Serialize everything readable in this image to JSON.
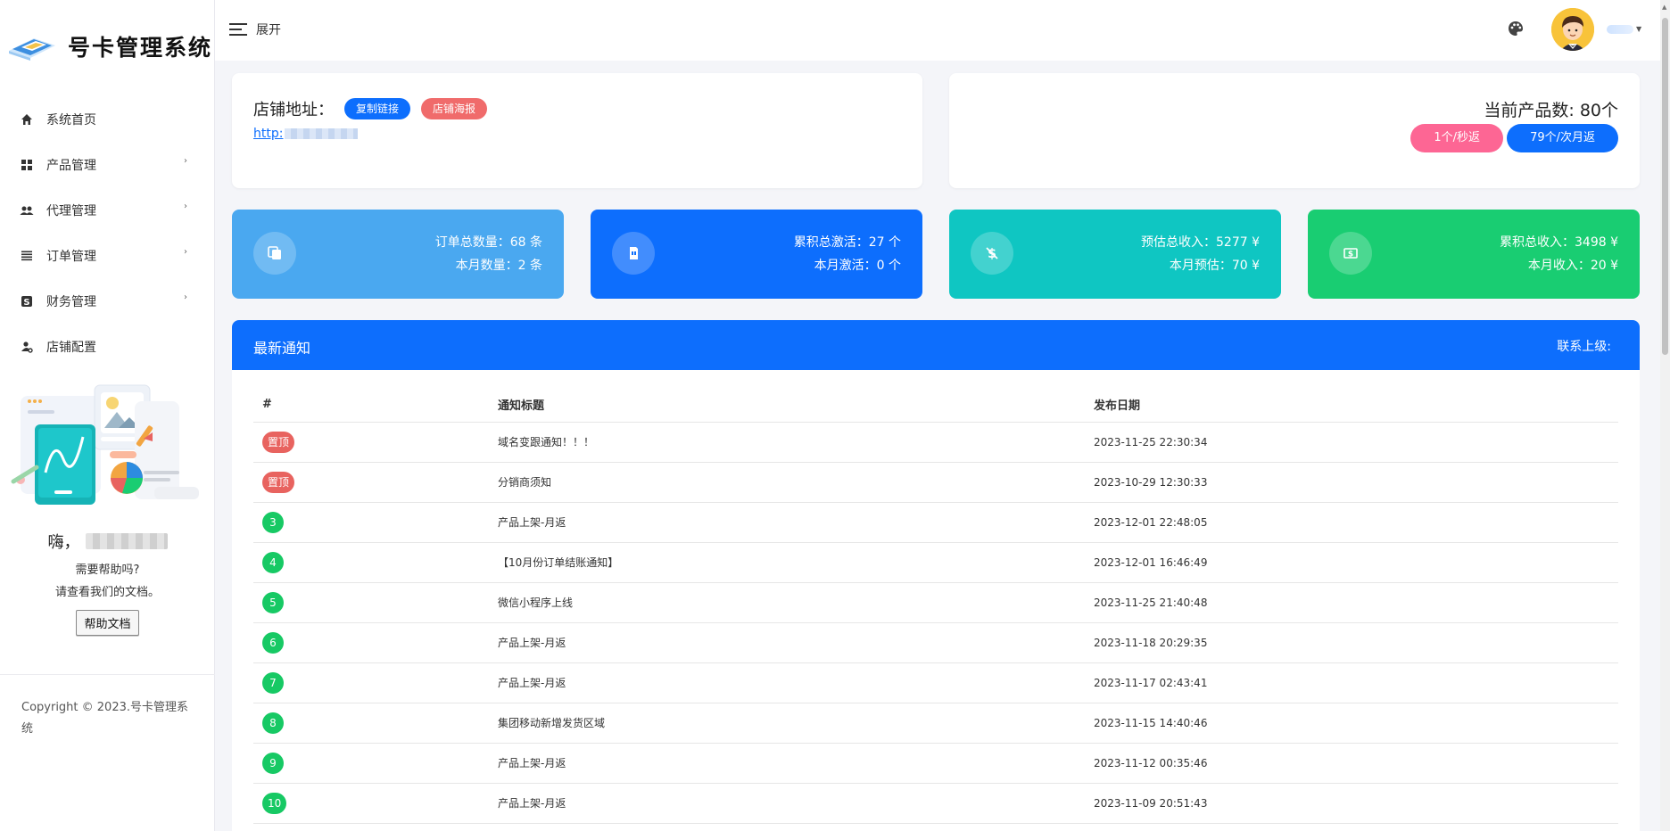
{
  "app": {
    "name": "号卡管理系统"
  },
  "sidebar": {
    "items": [
      {
        "label": "系统首页",
        "icon": "home-icon",
        "has_children": false
      },
      {
        "label": "产品管理",
        "icon": "grid-icon",
        "has_children": true
      },
      {
        "label": "代理管理",
        "icon": "users-icon",
        "has_children": true
      },
      {
        "label": "订单管理",
        "icon": "list-icon",
        "has_children": true
      },
      {
        "label": "财务管理",
        "icon": "dollar-icon",
        "has_children": true
      },
      {
        "label": "店铺配置",
        "icon": "user-gear-icon",
        "has_children": false
      }
    ],
    "promo": {
      "greeting": "嗨，",
      "help_line1": "需要帮助吗?",
      "help_line2": "请查看我们的文档。",
      "doc_button": "帮助文档"
    },
    "copyright": "Copyright © 2023.号卡管理系统"
  },
  "topbar": {
    "toggle_label": "展开",
    "theme_icon": "palette-icon"
  },
  "shop": {
    "label": "店铺地址：",
    "copy_link_button": "复制链接",
    "poster_button": "店铺海报",
    "url_prefix": "http:"
  },
  "products": {
    "count_text": "当前产品数: 80个",
    "badge_second": "1个/秒返",
    "badge_month": "79个/次月返"
  },
  "stats": [
    {
      "line1": "订单总数量：68 条",
      "line2": "本月数量：2 条",
      "icon": "copy-icon",
      "color": "#4aa8f0"
    },
    {
      "line1": "累积总激活：27 个",
      "line2": "本月激活：0 个",
      "icon": "sim-card-icon",
      "color": "#0d6efd"
    },
    {
      "line1": "预估总收入：5277 ¥",
      "line2": "本月预估：70 ¥",
      "icon": "dollar-slash-icon",
      "color": "#0fc6c2"
    },
    {
      "line1": "累积总收入：3498 ¥",
      "line2": "本月收入：20 ¥",
      "icon": "money-icon",
      "color": "#19cd72"
    }
  ],
  "notices": {
    "title": "最新通知",
    "contact": "联系上级:",
    "columns": [
      "#",
      "通知标题",
      "发布日期"
    ],
    "rows": [
      {
        "badge": "置顶",
        "type": "pinned",
        "title": "域名变跟通知！！！",
        "date": "2023-11-25 22:30:34"
      },
      {
        "badge": "置顶",
        "type": "pinned",
        "title": "分销商须知",
        "date": "2023-10-29 12:30:33"
      },
      {
        "badge": "3",
        "type": "num",
        "title": "产品上架-月返",
        "date": "2023-12-01 22:48:05"
      },
      {
        "badge": "4",
        "type": "num",
        "title": "【10月份订单结账通知】",
        "date": "2023-12-01 16:46:49"
      },
      {
        "badge": "5",
        "type": "num",
        "title": "微信小程序上线",
        "date": "2023-11-25 21:40:48"
      },
      {
        "badge": "6",
        "type": "num",
        "title": "产品上架-月返",
        "date": "2023-11-18 20:29:35"
      },
      {
        "badge": "7",
        "type": "num",
        "title": "产品上架-月返",
        "date": "2023-11-17 02:43:41"
      },
      {
        "badge": "8",
        "type": "num",
        "title": "集团移动新增发货区域",
        "date": "2023-11-15 14:40:46"
      },
      {
        "badge": "9",
        "type": "num",
        "title": "产品上架-月返",
        "date": "2023-11-12 00:35:46"
      },
      {
        "badge": "10",
        "type": "num",
        "title": "产品上架-月返",
        "date": "2023-11-09 20:51:43"
      }
    ]
  }
}
